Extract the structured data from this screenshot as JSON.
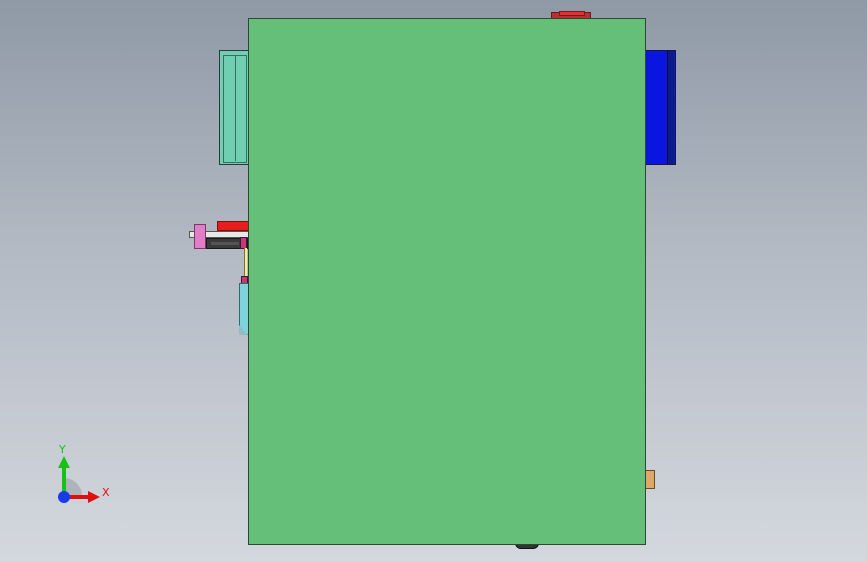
{
  "viewport": {
    "background_top": "#8f99a6",
    "background_bottom": "#d4d8de"
  },
  "model": {
    "main_plate_color": "#66bf79",
    "left_block_color": "#6fcfb0",
    "right_block_color": "#0a16e0",
    "top_tab_color": "#b83030",
    "pink_collar_color": "#e07fc8",
    "shaft_color": "#e8e8e8",
    "red_block_color": "#e81e1e",
    "dark_holder_color": "#3a3a3a",
    "magenta_color": "#c23a7a",
    "yellow_rod_color": "#f0ee9a",
    "cyan_clip_color": "#7fd3dc",
    "orange_pad_color": "#e0a868",
    "bottom_foot_color": "#333333"
  },
  "triad": {
    "x_label": "X",
    "y_label": "Y",
    "x_color": "#e01010",
    "y_color": "#18c018",
    "z_color": "#1a3ae8"
  }
}
